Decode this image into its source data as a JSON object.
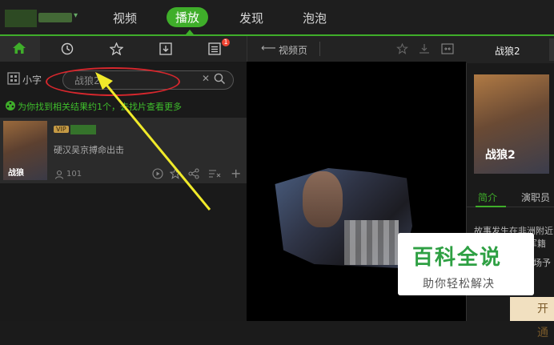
{
  "topbar": {
    "nav": [
      {
        "label": "视频"
      },
      {
        "label": "播放"
      },
      {
        "label": "发现"
      },
      {
        "label": "泡泡"
      }
    ],
    "active_index": 1,
    "accent": "#3fae2a"
  },
  "left": {
    "tabs": [
      "home-icon",
      "history-icon",
      "star-icon",
      "download-icon",
      "list-icon"
    ],
    "badge": "1",
    "mode_label": "小字",
    "search": {
      "value": "战狼2"
    },
    "hint": "为你找到相关结果约1个，去找片查看更多",
    "result": {
      "vip": "VIP",
      "desc": "硬汉吴京搏命出击",
      "plays": "101",
      "poster_text": "战狼"
    }
  },
  "center": {
    "back_label": "视频页"
  },
  "right": {
    "title": "战狼2",
    "poster_text": "战狼2",
    "tabs": [
      "简介",
      "演职员"
    ],
    "synopsis": [
      "故事发生在非洲附近",
      "军籍",
      "一场予"
    ],
    "open_label": "开通"
  },
  "watermark": {
    "title": "百科全说",
    "sub": "助你轻松解决"
  },
  "annotation": {
    "color": "#d6272d",
    "arrow": "#f0ea2a"
  }
}
